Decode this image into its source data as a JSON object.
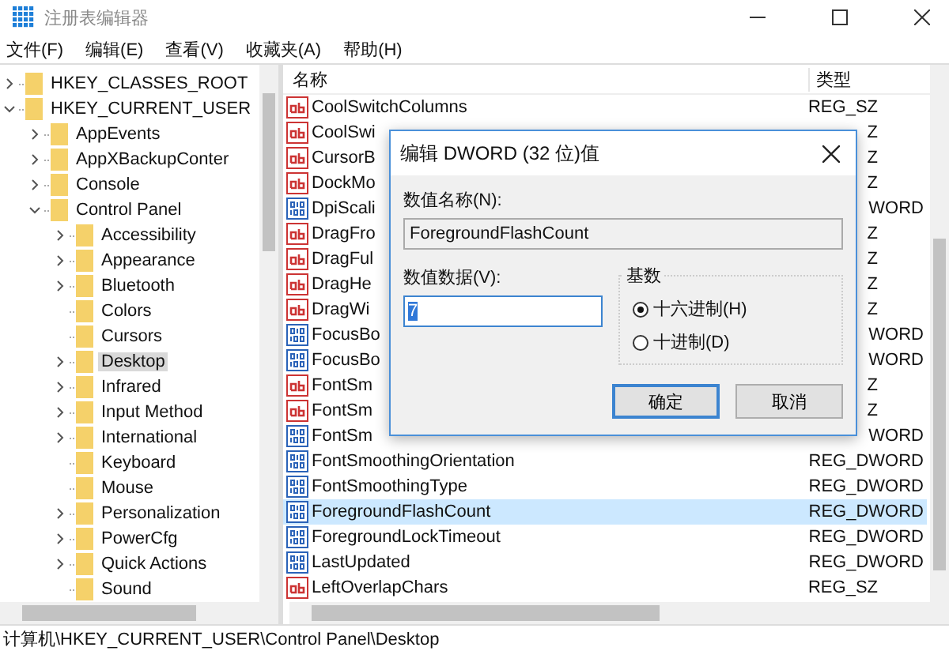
{
  "window": {
    "title": "注册表编辑器"
  },
  "menu": [
    "文件(F)",
    "编辑(E)",
    "查看(V)",
    "收藏夹(A)",
    "帮助(H)"
  ],
  "tree": [
    {
      "label": "HKEY_CLASSES_ROOT",
      "expandable": true,
      "expanded": false,
      "selected": false
    },
    {
      "label": "HKEY_CURRENT_USER",
      "expandable": true,
      "expanded": true,
      "selected": false,
      "children": [
        {
          "label": "AppEvents",
          "expandable": true,
          "expanded": false,
          "selected": false
        },
        {
          "label": "AppXBackupConter",
          "expandable": true,
          "expanded": false,
          "selected": false
        },
        {
          "label": "Console",
          "expandable": true,
          "expanded": false,
          "selected": false
        },
        {
          "label": "Control Panel",
          "expandable": true,
          "expanded": true,
          "selected": false,
          "children": [
            {
              "label": "Accessibility",
              "expandable": true,
              "expanded": false,
              "selected": false
            },
            {
              "label": "Appearance",
              "expandable": true,
              "expanded": false,
              "selected": false
            },
            {
              "label": "Bluetooth",
              "expandable": true,
              "expanded": false,
              "selected": false
            },
            {
              "label": "Colors",
              "expandable": false,
              "expanded": false,
              "selected": false
            },
            {
              "label": "Cursors",
              "expandable": false,
              "expanded": false,
              "selected": false
            },
            {
              "label": "Desktop",
              "expandable": true,
              "expanded": false,
              "selected": true
            },
            {
              "label": "Infrared",
              "expandable": true,
              "expanded": false,
              "selected": false
            },
            {
              "label": "Input Method",
              "expandable": true,
              "expanded": false,
              "selected": false
            },
            {
              "label": "International",
              "expandable": true,
              "expanded": false,
              "selected": false
            },
            {
              "label": "Keyboard",
              "expandable": false,
              "expanded": false,
              "selected": false
            },
            {
              "label": "Mouse",
              "expandable": false,
              "expanded": false,
              "selected": false
            },
            {
              "label": "Personalization",
              "expandable": true,
              "expanded": false,
              "selected": false
            },
            {
              "label": "PowerCfg",
              "expandable": true,
              "expanded": false,
              "selected": false
            },
            {
              "label": "Quick Actions",
              "expandable": true,
              "expanded": false,
              "selected": false
            },
            {
              "label": "Sound",
              "expandable": false,
              "expanded": false,
              "selected": false
            }
          ]
        }
      ]
    }
  ],
  "table": {
    "columns": [
      "名称",
      "类型"
    ],
    "rows": [
      {
        "kind": "string",
        "name": "CoolSwitchColumns",
        "type": "REG_SZ",
        "selected": false
      },
      {
        "kind": "string",
        "name": "CoolSwi",
        "type": "Z",
        "selected": false
      },
      {
        "kind": "string",
        "name": "CursorB",
        "type": "Z",
        "selected": false
      },
      {
        "kind": "string",
        "name": "DockMo",
        "type": "Z",
        "selected": false
      },
      {
        "kind": "dword",
        "name": "DpiScali",
        "type": "WORD",
        "selected": false
      },
      {
        "kind": "string",
        "name": "DragFro",
        "type": "Z",
        "selected": false
      },
      {
        "kind": "string",
        "name": "DragFul",
        "type": "Z",
        "selected": false
      },
      {
        "kind": "string",
        "name": "DragHe",
        "type": "Z",
        "selected": false
      },
      {
        "kind": "string",
        "name": "DragWi",
        "type": "Z",
        "selected": false
      },
      {
        "kind": "dword",
        "name": "FocusBo",
        "type": "WORD",
        "selected": false
      },
      {
        "kind": "dword",
        "name": "FocusBo",
        "type": "WORD",
        "selected": false
      },
      {
        "kind": "string",
        "name": "FontSm",
        "type": "Z",
        "selected": false
      },
      {
        "kind": "string",
        "name": "FontSm",
        "type": "Z",
        "selected": false
      },
      {
        "kind": "dword",
        "name": "FontSm",
        "type": "WORD",
        "selected": false
      },
      {
        "kind": "dword",
        "name": "FontSmoothingOrientation",
        "type": "REG_DWORD",
        "selected": false
      },
      {
        "kind": "dword",
        "name": "FontSmoothingType",
        "type": "REG_DWORD",
        "selected": false
      },
      {
        "kind": "dword",
        "name": "ForegroundFlashCount",
        "type": "REG_DWORD",
        "selected": true
      },
      {
        "kind": "dword",
        "name": "ForegroundLockTimeout",
        "type": "REG_DWORD",
        "selected": false
      },
      {
        "kind": "dword",
        "name": "LastUpdated",
        "type": "REG_DWORD",
        "selected": false
      },
      {
        "kind": "string",
        "name": "LeftOverlapChars",
        "type": "REG_SZ",
        "selected": false
      }
    ]
  },
  "dialog": {
    "title": "编辑 DWORD (32 位)值",
    "name_label": "数值名称(N):",
    "name_value": "ForegroundFlashCount",
    "data_label": "数值数据(V):",
    "data_value": "7",
    "base_label": "基数",
    "radios": [
      {
        "label": "十六进制(H)",
        "selected": true
      },
      {
        "label": "十进制(D)",
        "selected": false
      }
    ],
    "buttons": [
      {
        "label": "确定",
        "default": true
      },
      {
        "label": "取消",
        "default": false
      }
    ]
  },
  "status_bar": "计算机\\HKEY_CURRENT_USER\\Control Panel\\Desktop"
}
